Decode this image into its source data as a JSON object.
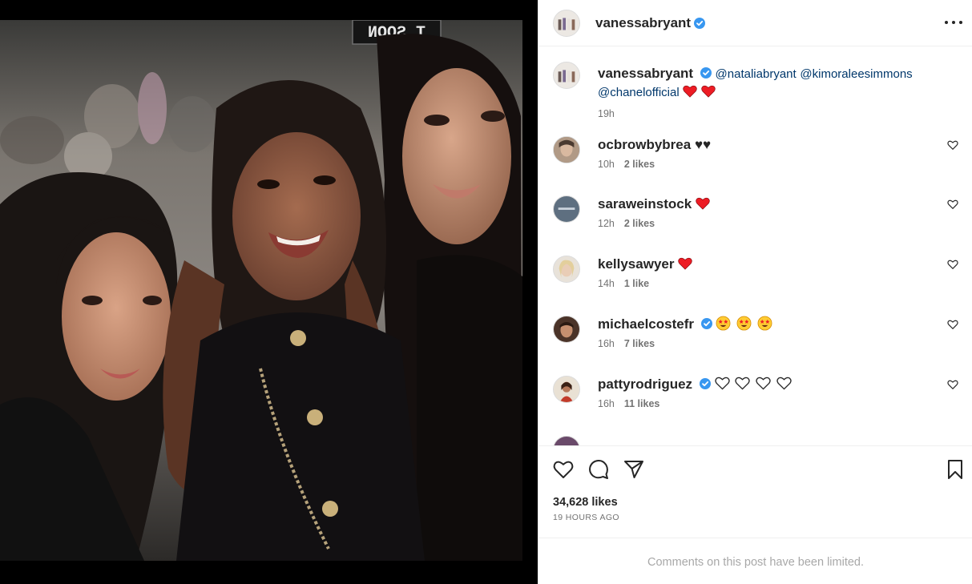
{
  "post": {
    "username": "vanessabryant",
    "verified": true,
    "caption": {
      "username": "vanessabryant",
      "mentions": [
        "@nataliabryant",
        "@kimoraleesimmons",
        "@chanelofficial"
      ],
      "emojis": [
        "red-heart",
        "red-heart"
      ],
      "time": "19h"
    },
    "photo_sign_text": "T SOON",
    "likes": "34,628 likes",
    "time_ago": "19 HOURS AGO",
    "comments_limited": "Comments on this post have been limited."
  },
  "comments": [
    {
      "username": "ocbrowbybrea",
      "verified": false,
      "text": "♥♥",
      "time": "10h",
      "likes": "2 likes",
      "avatar_color": "#8a7a6a"
    },
    {
      "username": "saraweinstock",
      "verified": false,
      "emoji": "red-heart",
      "time": "12h",
      "likes": "2 likes",
      "avatar_color": "#5e6f80"
    },
    {
      "username": "kellysawyer",
      "verified": false,
      "emoji": "red-heart",
      "time": "14h",
      "likes": "1 like",
      "avatar_color": "#d9c7b3"
    },
    {
      "username": "michaelcostefr",
      "verified": true,
      "emojis": [
        "star-struck",
        "star-struck",
        "star-struck"
      ],
      "time": "16h",
      "likes": "7 likes",
      "avatar_color": "#6b4a3a"
    },
    {
      "username": "pattyrodriguez",
      "verified": true,
      "emojis": [
        "white-heart",
        "white-heart",
        "white-heart",
        "white-heart"
      ],
      "time": "16h",
      "likes": "11 likes",
      "avatar_color": "#9b5a3c"
    }
  ],
  "colors": {
    "verified": "#3897f0",
    "heart_red": "#ed1c24",
    "link": "#00376b",
    "muted": "#737373"
  }
}
